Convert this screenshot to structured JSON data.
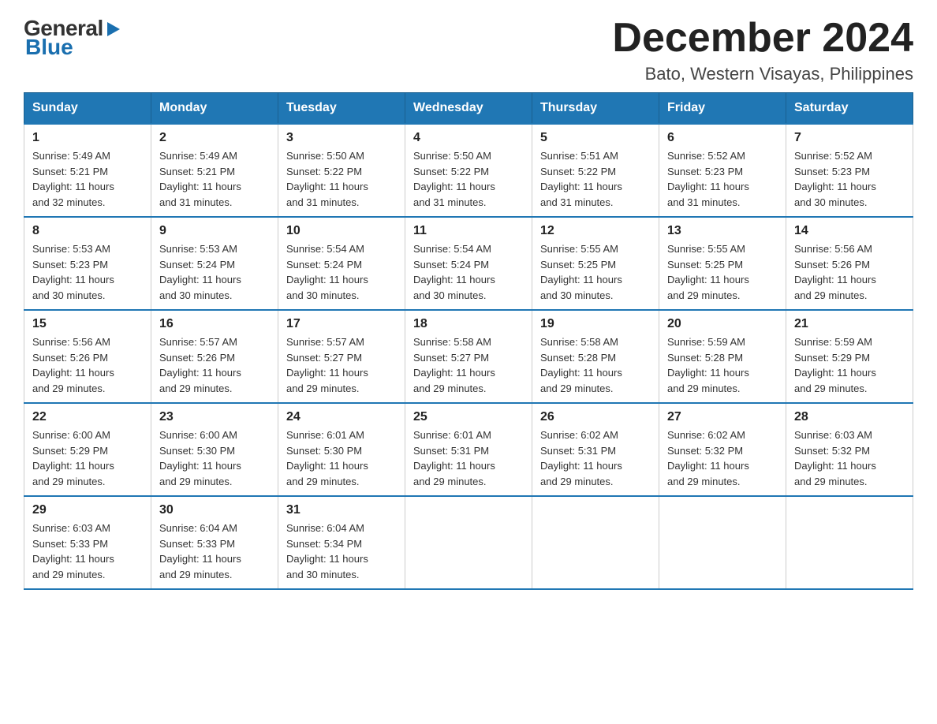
{
  "logo": {
    "general": "General",
    "blue": "Blue",
    "arrow": "▶"
  },
  "header": {
    "month_year": "December 2024",
    "location": "Bato, Western Visayas, Philippines"
  },
  "weekdays": [
    "Sunday",
    "Monday",
    "Tuesday",
    "Wednesday",
    "Thursday",
    "Friday",
    "Saturday"
  ],
  "weeks": [
    [
      {
        "day": "1",
        "sunrise": "5:49 AM",
        "sunset": "5:21 PM",
        "daylight": "11 hours and 32 minutes."
      },
      {
        "day": "2",
        "sunrise": "5:49 AM",
        "sunset": "5:21 PM",
        "daylight": "11 hours and 31 minutes."
      },
      {
        "day": "3",
        "sunrise": "5:50 AM",
        "sunset": "5:22 PM",
        "daylight": "11 hours and 31 minutes."
      },
      {
        "day": "4",
        "sunrise": "5:50 AM",
        "sunset": "5:22 PM",
        "daylight": "11 hours and 31 minutes."
      },
      {
        "day": "5",
        "sunrise": "5:51 AM",
        "sunset": "5:22 PM",
        "daylight": "11 hours and 31 minutes."
      },
      {
        "day": "6",
        "sunrise": "5:52 AM",
        "sunset": "5:23 PM",
        "daylight": "11 hours and 31 minutes."
      },
      {
        "day": "7",
        "sunrise": "5:52 AM",
        "sunset": "5:23 PM",
        "daylight": "11 hours and 30 minutes."
      }
    ],
    [
      {
        "day": "8",
        "sunrise": "5:53 AM",
        "sunset": "5:23 PM",
        "daylight": "11 hours and 30 minutes."
      },
      {
        "day": "9",
        "sunrise": "5:53 AM",
        "sunset": "5:24 PM",
        "daylight": "11 hours and 30 minutes."
      },
      {
        "day": "10",
        "sunrise": "5:54 AM",
        "sunset": "5:24 PM",
        "daylight": "11 hours and 30 minutes."
      },
      {
        "day": "11",
        "sunrise": "5:54 AM",
        "sunset": "5:24 PM",
        "daylight": "11 hours and 30 minutes."
      },
      {
        "day": "12",
        "sunrise": "5:55 AM",
        "sunset": "5:25 PM",
        "daylight": "11 hours and 30 minutes."
      },
      {
        "day": "13",
        "sunrise": "5:55 AM",
        "sunset": "5:25 PM",
        "daylight": "11 hours and 29 minutes."
      },
      {
        "day": "14",
        "sunrise": "5:56 AM",
        "sunset": "5:26 PM",
        "daylight": "11 hours and 29 minutes."
      }
    ],
    [
      {
        "day": "15",
        "sunrise": "5:56 AM",
        "sunset": "5:26 PM",
        "daylight": "11 hours and 29 minutes."
      },
      {
        "day": "16",
        "sunrise": "5:57 AM",
        "sunset": "5:26 PM",
        "daylight": "11 hours and 29 minutes."
      },
      {
        "day": "17",
        "sunrise": "5:57 AM",
        "sunset": "5:27 PM",
        "daylight": "11 hours and 29 minutes."
      },
      {
        "day": "18",
        "sunrise": "5:58 AM",
        "sunset": "5:27 PM",
        "daylight": "11 hours and 29 minutes."
      },
      {
        "day": "19",
        "sunrise": "5:58 AM",
        "sunset": "5:28 PM",
        "daylight": "11 hours and 29 minutes."
      },
      {
        "day": "20",
        "sunrise": "5:59 AM",
        "sunset": "5:28 PM",
        "daylight": "11 hours and 29 minutes."
      },
      {
        "day": "21",
        "sunrise": "5:59 AM",
        "sunset": "5:29 PM",
        "daylight": "11 hours and 29 minutes."
      }
    ],
    [
      {
        "day": "22",
        "sunrise": "6:00 AM",
        "sunset": "5:29 PM",
        "daylight": "11 hours and 29 minutes."
      },
      {
        "day": "23",
        "sunrise": "6:00 AM",
        "sunset": "5:30 PM",
        "daylight": "11 hours and 29 minutes."
      },
      {
        "day": "24",
        "sunrise": "6:01 AM",
        "sunset": "5:30 PM",
        "daylight": "11 hours and 29 minutes."
      },
      {
        "day": "25",
        "sunrise": "6:01 AM",
        "sunset": "5:31 PM",
        "daylight": "11 hours and 29 minutes."
      },
      {
        "day": "26",
        "sunrise": "6:02 AM",
        "sunset": "5:31 PM",
        "daylight": "11 hours and 29 minutes."
      },
      {
        "day": "27",
        "sunrise": "6:02 AM",
        "sunset": "5:32 PM",
        "daylight": "11 hours and 29 minutes."
      },
      {
        "day": "28",
        "sunrise": "6:03 AM",
        "sunset": "5:32 PM",
        "daylight": "11 hours and 29 minutes."
      }
    ],
    [
      {
        "day": "29",
        "sunrise": "6:03 AM",
        "sunset": "5:33 PM",
        "daylight": "11 hours and 29 minutes."
      },
      {
        "day": "30",
        "sunrise": "6:04 AM",
        "sunset": "5:33 PM",
        "daylight": "11 hours and 29 minutes."
      },
      {
        "day": "31",
        "sunrise": "6:04 AM",
        "sunset": "5:34 PM",
        "daylight": "11 hours and 30 minutes."
      },
      null,
      null,
      null,
      null
    ]
  ],
  "labels": {
    "sunrise": "Sunrise:",
    "sunset": "Sunset:",
    "daylight": "Daylight:"
  }
}
